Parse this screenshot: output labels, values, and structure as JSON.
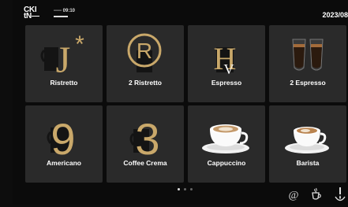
{
  "status": {
    "brand_line1": "CKI",
    "brand_line2": "tN—",
    "clock": "----- 09:10",
    "date": "2023/08"
  },
  "tiles": [
    {
      "label": "Ristretto",
      "icon": "letter-j-star-icon"
    },
    {
      "label": "2 Ristretto",
      "icon": "registered-r-icon"
    },
    {
      "label": "Espresso",
      "icon": "letter-h-v-icon"
    },
    {
      "label": "2 Espresso",
      "icon": "double-espresso-glasses-icon"
    },
    {
      "label": "Americano",
      "icon": "number-9-icon"
    },
    {
      "label": "Coffee Crema",
      "icon": "number-3-icon"
    },
    {
      "label": "Cappuccino",
      "icon": "cappuccino-cup-icon"
    },
    {
      "label": "Barista",
      "icon": "barista-cup-icon"
    }
  ],
  "glyphs": {
    "j": "J",
    "star": "*",
    "r": "R",
    "h": "H",
    "v": "V",
    "nine": "9",
    "three": "3"
  },
  "pager": {
    "pages": 3,
    "current": 1
  },
  "bottom": {
    "at_label": "@"
  },
  "colors": {
    "tile": "#2a2a2a",
    "gold": "#c9a86a",
    "background": "#0b0b0b"
  }
}
